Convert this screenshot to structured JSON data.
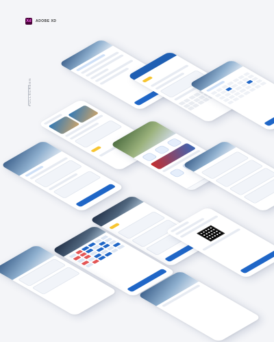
{
  "badge": {
    "logo_text": "Xd",
    "label": "ADOBE XD"
  },
  "side_label": "FULLSCREEN"
}
